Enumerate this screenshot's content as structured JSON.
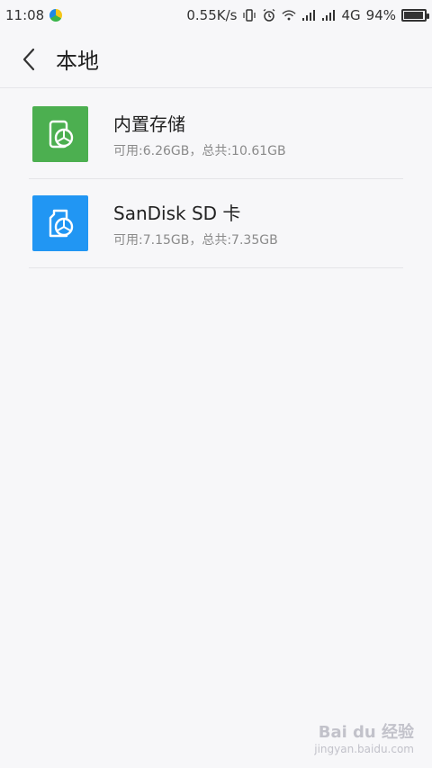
{
  "status_bar": {
    "time": "11:08",
    "network_speed": "0.55K/s",
    "network_type": "4G",
    "battery": "94%",
    "battery_level": 0.94,
    "icons": [
      "vibrate-icon",
      "alarm-icon",
      "wifi-icon",
      "signal-icon",
      "signal-icon"
    ]
  },
  "app_bar": {
    "back_icon": "chevron-left-icon",
    "title": "本地"
  },
  "storage": {
    "items": [
      {
        "title": "内置存储",
        "subtitle": "可用:6.26GB，总共:10.61GB",
        "icon": "phone-storage-icon",
        "color": "#4caf50"
      },
      {
        "title": "SanDisk SD 卡",
        "subtitle": "可用:7.15GB，总共:7.35GB",
        "icon": "sd-card-icon",
        "color": "#2196f3"
      }
    ]
  },
  "watermark": {
    "main": "Bai du 经验",
    "sub": "jingyan.baidu.com"
  }
}
